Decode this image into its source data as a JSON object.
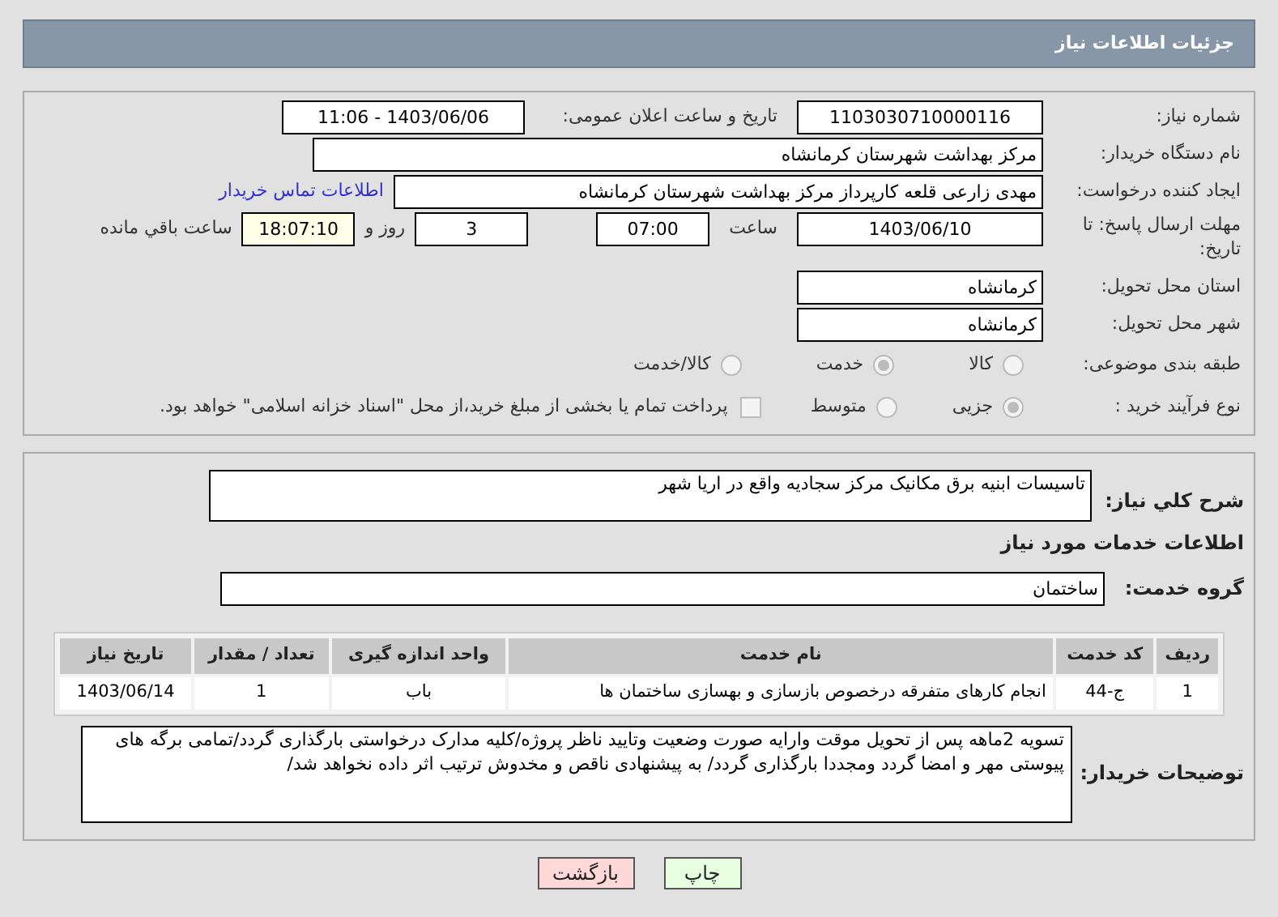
{
  "header": {
    "title": "جزئیات اطلاعات نیاز"
  },
  "need_number": {
    "label": "شماره نیاز:",
    "value": "1103030710000116"
  },
  "announce": {
    "label": "تاریخ و ساعت اعلان عمومی:",
    "value": "1403/06/06 - 11:06"
  },
  "buyer": {
    "label": "نام دستگاه خریدار:",
    "value": "مرکز بهداشت شهرستان کرمانشاه"
  },
  "creator": {
    "label": "ایجاد کننده درخواست:",
    "value": "مهدی  زارعی قلعه کارپرداز مرکز بهداشت شهرستان کرمانشاه",
    "link": "اطلاعات تماس خریدار"
  },
  "deadline": {
    "label": "مهلت ارسال پاسخ: تا تاریخ:",
    "date": "1403/06/10",
    "time_label": "ساعت",
    "time": "07:00",
    "days": "3",
    "days_label": "روز و",
    "remaining": "18:07:10",
    "remaining_label": "ساعت باقي مانده"
  },
  "province": {
    "label": "استان محل تحویل:",
    "value": "کرمانشاه"
  },
  "city": {
    "label": "شهر محل تحویل:",
    "value": "کرمانشاه"
  },
  "category": {
    "label": "طبقه بندی موضوعی:",
    "options": [
      {
        "label": "کالا",
        "selected": false
      },
      {
        "label": "خدمت",
        "selected": true
      },
      {
        "label": "کالا/خدمت",
        "selected": false
      }
    ]
  },
  "purchase_type": {
    "label": "نوع فرآیند خرید :",
    "options": [
      {
        "label": "جزیی",
        "selected": true
      },
      {
        "label": "متوسط",
        "selected": false
      }
    ],
    "checkbox": {
      "checked": false,
      "label": "پرداخت تمام یا بخشی از مبلغ خرید،از محل \"اسناد خزانه اسلامی\" خواهد بود."
    }
  },
  "description": {
    "label": "شرح كلي نياز:",
    "value": "تاسیسات ابنیه برق مکانیک مرکز سجادیه واقع در اریا شهر"
  },
  "services_heading": "اطلاعات خدمات مورد نیاز",
  "service_group": {
    "label": "گروه خدمت:",
    "value": "ساختمان"
  },
  "table": {
    "columns": [
      "ردیف",
      "کد خدمت",
      "نام خدمت",
      "واحد اندازه گیری",
      "تعداد / مقدار",
      "تاریخ نیاز"
    ],
    "rows": [
      [
        "1",
        "ج-44",
        "انجام کارهای متفرقه درخصوص بازسازی و بهسازی ساختمان ها",
        "باب",
        "1",
        "1403/06/14"
      ]
    ]
  },
  "buyer_notes": {
    "label": "توضیحات خریدار:",
    "value": "تسویه 2ماهه پس از تحویل موقت وارایه صورت وضعیت وتایید ناظر پروژه/کلیه مدارک درخواستی بارگذاری گردد/تمامی برگه های پیوستی مهر و امضا گردد ومجددا بارگذاری گردد/ به پیشنهادی ناقص و مخدوش ترتیب اثر داده نخواهد شد/"
  },
  "buttons": [
    {
      "label": "چاپ",
      "kind": "print"
    },
    {
      "label": "بازگشت",
      "kind": "back"
    }
  ]
}
